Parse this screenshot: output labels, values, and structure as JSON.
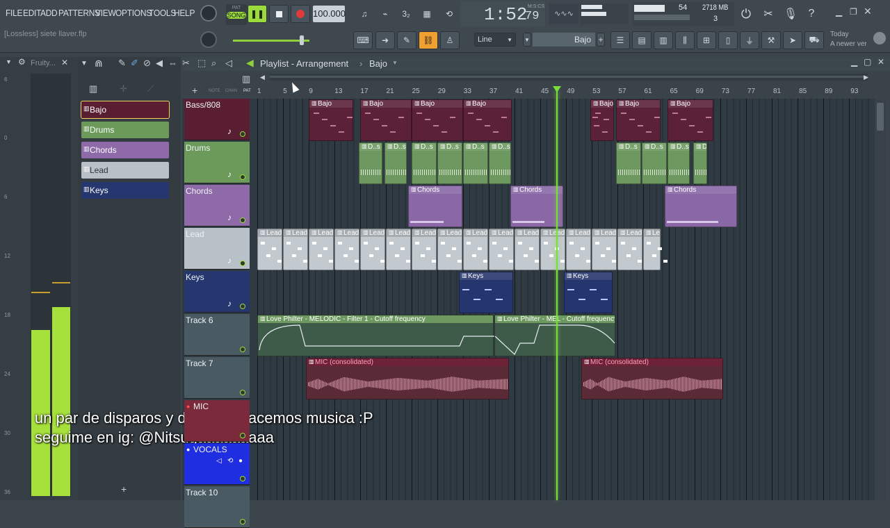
{
  "menu": [
    "FILE",
    "EDIT",
    "ADD",
    "PATTERNS",
    "VIEW",
    "OPTIONS",
    "TOOLS",
    "HELP"
  ],
  "transport": {
    "mode_top": "PAT",
    "mode_bottom": "SONG",
    "tempo": "100.000",
    "time": "1:52",
    "time_small": "79",
    "time_label": "M:S:CS"
  },
  "status": {
    "cpu_value": "54",
    "ram_value": "2718 MB",
    "voices": "3",
    "news_title": "Today",
    "news_item": "A newer versi"
  },
  "project_file": "[Lossless] siete llaver.flp",
  "snap": {
    "label": "Line",
    "pattern": "Bajo"
  },
  "playlist": {
    "title": "Playlist - Arrangement",
    "arrow": "›",
    "pattern": "Bajo",
    "col_note": "NOTE",
    "col_chan": "CHAN",
    "col_pat": "PAT"
  },
  "browser": {
    "title": "Fruity..."
  },
  "picker": [
    {
      "label": "Bajo",
      "color": "#5a1e33",
      "sel": true
    },
    {
      "label": "Drums",
      "color": "#6b9a5a"
    },
    {
      "label": "Chords",
      "color": "#8e6aa8"
    },
    {
      "label": "Lead",
      "color": "#b8c0c8"
    },
    {
      "label": "Keys",
      "color": "#26366e"
    }
  ],
  "ruler": [
    "1",
    "5",
    "9",
    "13",
    "17",
    "21",
    "25",
    "29",
    "33",
    "37",
    "41",
    "45",
    "49",
    "53",
    "57",
    "61",
    "65",
    "69",
    "73",
    "77",
    "81",
    "85",
    "89",
    "93"
  ],
  "tracks": [
    {
      "name": "Bass/808",
      "color": "#5a1e33"
    },
    {
      "name": "Drums",
      "color": "#6b9a5a"
    },
    {
      "name": "Chords",
      "color": "#8e6aa8"
    },
    {
      "name": "Lead",
      "color": "#b8c0c8"
    },
    {
      "name": "Keys",
      "color": "#26366e"
    },
    {
      "name": "Track 6",
      "color": "#4a5a62"
    },
    {
      "name": "Track 7",
      "color": "#4a5a62"
    },
    {
      "name": "MIC",
      "color": "#7a2a3a"
    },
    {
      "name": "VOCALS",
      "color": "#1e2ee0"
    },
    {
      "name": "Track 10",
      "color": "#4a5a62"
    }
  ],
  "clips": {
    "bajo": "Bajo",
    "drums": "D..s",
    "chords": "Chords",
    "lead": "Lead",
    "keys": "Keys",
    "auto1": "Love Philter - MELODIC - Filter 1 - Cutoff frequency",
    "auto2": "Love Philter - MEL - Cutoff frequency",
    "mic": "MIC (consolidated)"
  },
  "meter_labels": [
    "6",
    "0",
    "6",
    "12",
    "18",
    "24",
    "30",
    "36"
  ],
  "subtitles": [
    "un par de disparos y después hacemos musica :P",
    "seguime en ig: @Nitsugaaaaaaaaa"
  ],
  "colors": {
    "playhead": "#7adf3a",
    "meter": "#a6e03a",
    "accent": "#f0a030"
  }
}
